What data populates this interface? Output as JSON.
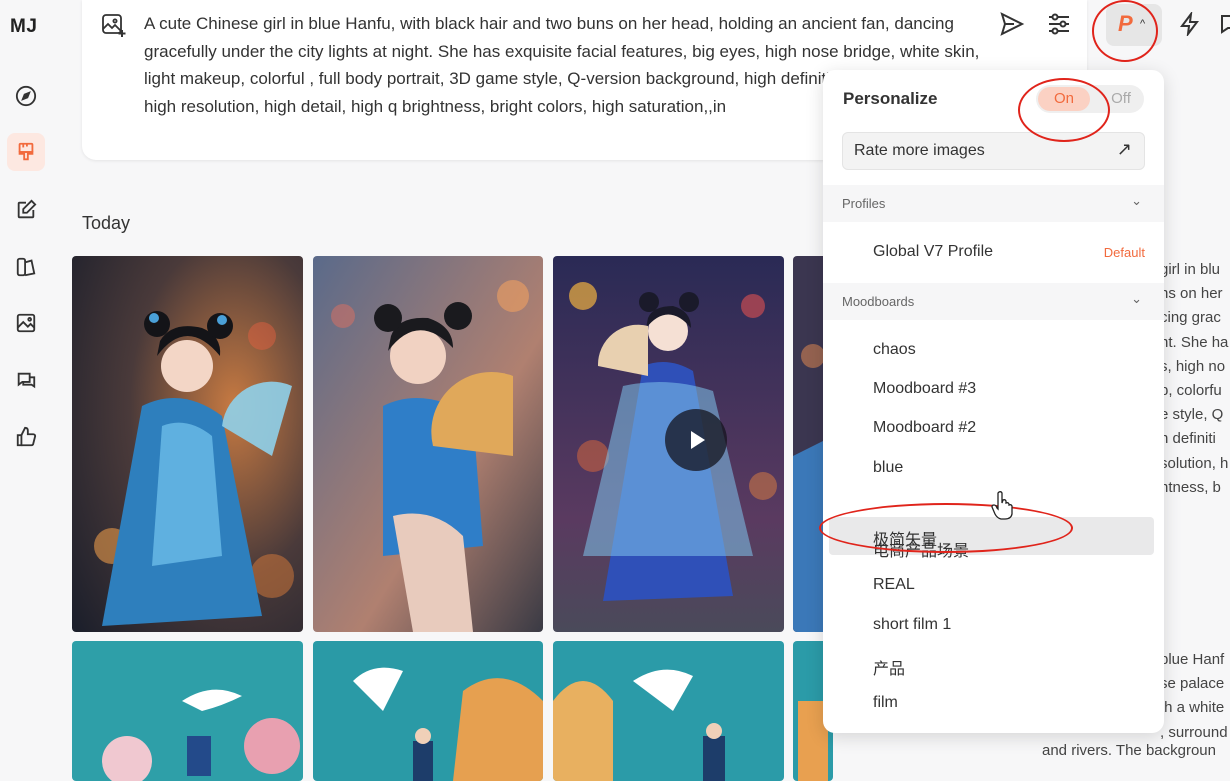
{
  "app": {
    "logo": "MJ"
  },
  "sidebar": {
    "items": [
      {
        "name": "explore",
        "icon": "compass-icon"
      },
      {
        "name": "create",
        "icon": "paintbrush-icon"
      },
      {
        "name": "edit",
        "icon": "edit-icon"
      },
      {
        "name": "personalize",
        "icon": "personalize-icon"
      },
      {
        "name": "organize",
        "icon": "image-icon"
      },
      {
        "name": "chat",
        "icon": "chat-icon"
      },
      {
        "name": "rank",
        "icon": "thumbs-up-icon"
      }
    ]
  },
  "prompt": {
    "text": "A cute Chinese girl in blue Hanfu, with black hair and two buns on her head, holding an ancient fan, dancing gracefully under the city lights at night. She has exquisite facial features, big eyes, high nose bridge, white skin, light makeup, colorful , full body portrait, 3D game style, Q-version background, high definition wallpaper, cartoon, high resolution, high detail, high q brightness, bright colors, high saturation,,in"
  },
  "toolbar": {
    "personalize_letter": "P",
    "chevron": "^"
  },
  "feed": {
    "today_label": "Today"
  },
  "right_column": {
    "lines_a": [
      "girl in blu",
      "ns on her",
      "cing grac",
      "nt. She ha",
      "s, high no",
      "p, colorfu",
      "e style, Q",
      "h definiti",
      "solution, h",
      "htness, b"
    ],
    "lines_b": [
      "blue Hanf",
      "se palace",
      "th a white",
      ", surround"
    ],
    "line_c": "and rivers. The backgroun"
  },
  "panel": {
    "title": "Personalize",
    "toggle_on": "On",
    "toggle_off": "Off",
    "rate_label": "Rate more images",
    "rate_arrow": "↗",
    "profiles_label": "Profiles",
    "profile_name": "Global V7 Profile",
    "profile_default": "Default",
    "moodboards_label": "Moodboards",
    "moodboards": [
      "chaos",
      "Moodboard #3",
      "Moodboard #2",
      "blue",
      "极简矢量",
      "电商产品场景",
      "REAL",
      "short film 1",
      "产品",
      "film"
    ]
  },
  "colors": {
    "accent": "#f26a3d",
    "annotation": "#e0241b"
  }
}
